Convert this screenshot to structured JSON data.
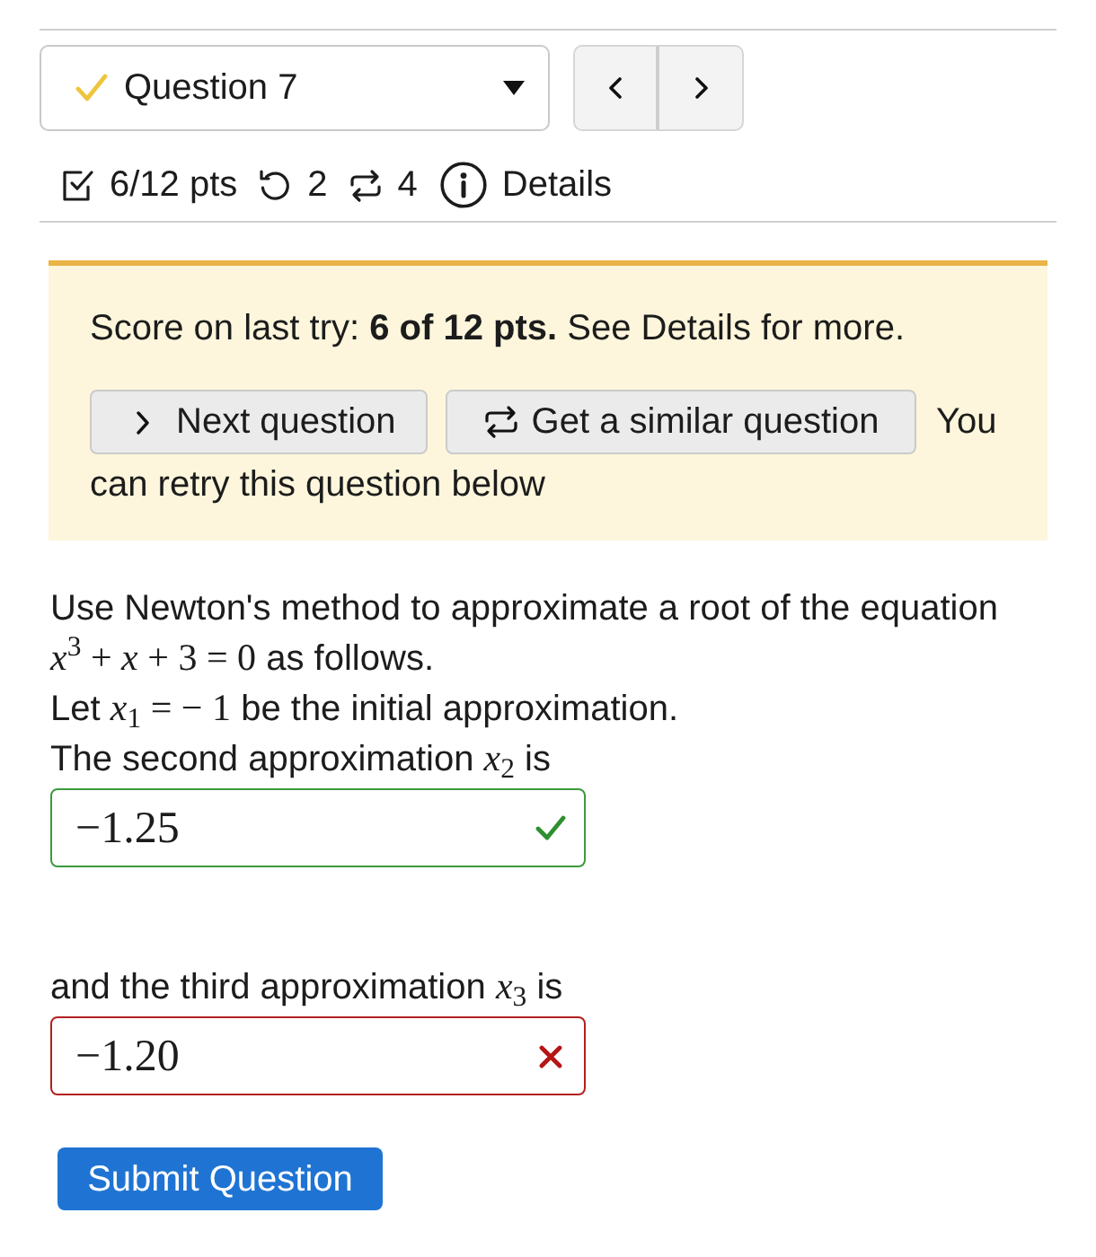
{
  "question_select": {
    "label": "Question 7",
    "partial": true
  },
  "stats": [
    {
      "kind": "points",
      "text": "6/12 pts"
    },
    {
      "kind": "retries",
      "text": "2"
    },
    {
      "kind": "versions",
      "text": "4"
    },
    {
      "kind": "details",
      "text": "Details"
    }
  ],
  "notice": {
    "message": "Score on last try: **6 of 12 pts.** See Details for more.",
    "buttons": [
      {
        "kind": "next",
        "label": "Next question"
      },
      {
        "kind": "similar",
        "label": "Get a similar question"
      }
    ],
    "note_lines": [
      "You",
      "can retry this question below"
    ]
  },
  "question": [
    {
      "kind": "text",
      "segments": [
        {
          "kind": "plain",
          "text": "Use Newton's method to approximate a root of the equation"
        },
        {
          "kind": "math",
          "text": "*x*$^{3}$ + *x* + 3 = 0"
        },
        {
          "kind": "plain",
          "text": "as follows."
        }
      ]
    },
    {
      "kind": "text",
      "segments": [
        {
          "kind": "plain",
          "text": "Let"
        },
        {
          "kind": "math",
          "text": "*x*$_{1}$ = − 1"
        },
        {
          "kind": "plain",
          "text": "be the initial approximation."
        }
      ]
    },
    {
      "kind": "text",
      "segments": [
        {
          "kind": "plain",
          "text": "The second approximation"
        },
        {
          "kind": "math",
          "text": "*x*$_{2}$"
        },
        {
          "kind": "plain",
          "text": "is"
        }
      ]
    },
    {
      "kind": "answer",
      "value": "−1.25",
      "correct": true
    },
    {
      "kind": "text",
      "segments": [
        {
          "kind": "plain",
          "text": "and the third approximation"
        },
        {
          "kind": "math",
          "text": "*x*$_{3}$"
        },
        {
          "kind": "plain",
          "text": "is"
        }
      ]
    },
    {
      "kind": "answer",
      "value": "−1.20",
      "correct": false
    }
  ],
  "submit": {
    "label": "Submit Question"
  }
}
